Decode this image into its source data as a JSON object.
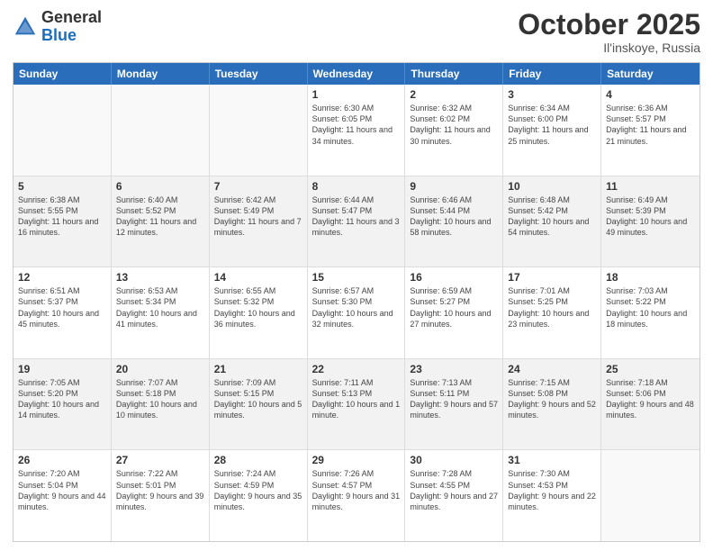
{
  "logo": {
    "general": "General",
    "blue": "Blue"
  },
  "header": {
    "title": "October 2025",
    "subtitle": "Il'inskoye, Russia"
  },
  "days_of_week": [
    "Sunday",
    "Monday",
    "Tuesday",
    "Wednesday",
    "Thursday",
    "Friday",
    "Saturday"
  ],
  "weeks": [
    [
      {
        "day": "",
        "info": "",
        "empty": true
      },
      {
        "day": "",
        "info": "",
        "empty": true
      },
      {
        "day": "",
        "info": "",
        "empty": true
      },
      {
        "day": "1",
        "info": "Sunrise: 6:30 AM\nSunset: 6:05 PM\nDaylight: 11 hours and 34 minutes.",
        "empty": false
      },
      {
        "day": "2",
        "info": "Sunrise: 6:32 AM\nSunset: 6:02 PM\nDaylight: 11 hours and 30 minutes.",
        "empty": false
      },
      {
        "day": "3",
        "info": "Sunrise: 6:34 AM\nSunset: 6:00 PM\nDaylight: 11 hours and 25 minutes.",
        "empty": false
      },
      {
        "day": "4",
        "info": "Sunrise: 6:36 AM\nSunset: 5:57 PM\nDaylight: 11 hours and 21 minutes.",
        "empty": false
      }
    ],
    [
      {
        "day": "5",
        "info": "Sunrise: 6:38 AM\nSunset: 5:55 PM\nDaylight: 11 hours and 16 minutes.",
        "empty": false
      },
      {
        "day": "6",
        "info": "Sunrise: 6:40 AM\nSunset: 5:52 PM\nDaylight: 11 hours and 12 minutes.",
        "empty": false
      },
      {
        "day": "7",
        "info": "Sunrise: 6:42 AM\nSunset: 5:49 PM\nDaylight: 11 hours and 7 minutes.",
        "empty": false
      },
      {
        "day": "8",
        "info": "Sunrise: 6:44 AM\nSunset: 5:47 PM\nDaylight: 11 hours and 3 minutes.",
        "empty": false
      },
      {
        "day": "9",
        "info": "Sunrise: 6:46 AM\nSunset: 5:44 PM\nDaylight: 10 hours and 58 minutes.",
        "empty": false
      },
      {
        "day": "10",
        "info": "Sunrise: 6:48 AM\nSunset: 5:42 PM\nDaylight: 10 hours and 54 minutes.",
        "empty": false
      },
      {
        "day": "11",
        "info": "Sunrise: 6:49 AM\nSunset: 5:39 PM\nDaylight: 10 hours and 49 minutes.",
        "empty": false
      }
    ],
    [
      {
        "day": "12",
        "info": "Sunrise: 6:51 AM\nSunset: 5:37 PM\nDaylight: 10 hours and 45 minutes.",
        "empty": false
      },
      {
        "day": "13",
        "info": "Sunrise: 6:53 AM\nSunset: 5:34 PM\nDaylight: 10 hours and 41 minutes.",
        "empty": false
      },
      {
        "day": "14",
        "info": "Sunrise: 6:55 AM\nSunset: 5:32 PM\nDaylight: 10 hours and 36 minutes.",
        "empty": false
      },
      {
        "day": "15",
        "info": "Sunrise: 6:57 AM\nSunset: 5:30 PM\nDaylight: 10 hours and 32 minutes.",
        "empty": false
      },
      {
        "day": "16",
        "info": "Sunrise: 6:59 AM\nSunset: 5:27 PM\nDaylight: 10 hours and 27 minutes.",
        "empty": false
      },
      {
        "day": "17",
        "info": "Sunrise: 7:01 AM\nSunset: 5:25 PM\nDaylight: 10 hours and 23 minutes.",
        "empty": false
      },
      {
        "day": "18",
        "info": "Sunrise: 7:03 AM\nSunset: 5:22 PM\nDaylight: 10 hours and 18 minutes.",
        "empty": false
      }
    ],
    [
      {
        "day": "19",
        "info": "Sunrise: 7:05 AM\nSunset: 5:20 PM\nDaylight: 10 hours and 14 minutes.",
        "empty": false
      },
      {
        "day": "20",
        "info": "Sunrise: 7:07 AM\nSunset: 5:18 PM\nDaylight: 10 hours and 10 minutes.",
        "empty": false
      },
      {
        "day": "21",
        "info": "Sunrise: 7:09 AM\nSunset: 5:15 PM\nDaylight: 10 hours and 5 minutes.",
        "empty": false
      },
      {
        "day": "22",
        "info": "Sunrise: 7:11 AM\nSunset: 5:13 PM\nDaylight: 10 hours and 1 minute.",
        "empty": false
      },
      {
        "day": "23",
        "info": "Sunrise: 7:13 AM\nSunset: 5:11 PM\nDaylight: 9 hours and 57 minutes.",
        "empty": false
      },
      {
        "day": "24",
        "info": "Sunrise: 7:15 AM\nSunset: 5:08 PM\nDaylight: 9 hours and 52 minutes.",
        "empty": false
      },
      {
        "day": "25",
        "info": "Sunrise: 7:18 AM\nSunset: 5:06 PM\nDaylight: 9 hours and 48 minutes.",
        "empty": false
      }
    ],
    [
      {
        "day": "26",
        "info": "Sunrise: 7:20 AM\nSunset: 5:04 PM\nDaylight: 9 hours and 44 minutes.",
        "empty": false
      },
      {
        "day": "27",
        "info": "Sunrise: 7:22 AM\nSunset: 5:01 PM\nDaylight: 9 hours and 39 minutes.",
        "empty": false
      },
      {
        "day": "28",
        "info": "Sunrise: 7:24 AM\nSunset: 4:59 PM\nDaylight: 9 hours and 35 minutes.",
        "empty": false
      },
      {
        "day": "29",
        "info": "Sunrise: 7:26 AM\nSunset: 4:57 PM\nDaylight: 9 hours and 31 minutes.",
        "empty": false
      },
      {
        "day": "30",
        "info": "Sunrise: 7:28 AM\nSunset: 4:55 PM\nDaylight: 9 hours and 27 minutes.",
        "empty": false
      },
      {
        "day": "31",
        "info": "Sunrise: 7:30 AM\nSunset: 4:53 PM\nDaylight: 9 hours and 22 minutes.",
        "empty": false
      },
      {
        "day": "",
        "info": "",
        "empty": true
      }
    ]
  ]
}
